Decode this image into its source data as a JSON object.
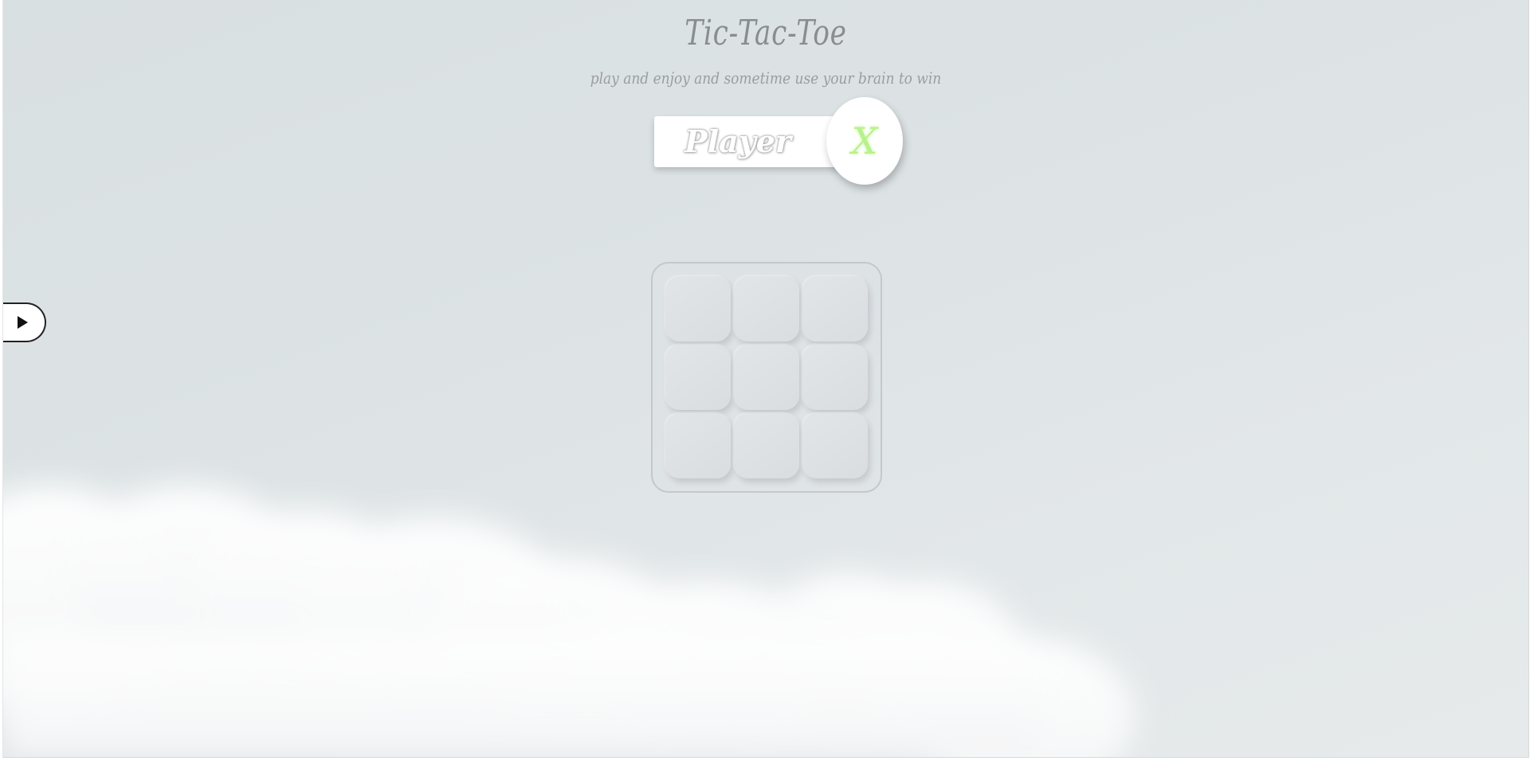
{
  "game": {
    "title": "Tic-Tac-Toe",
    "subtitle": "play and enjoy and sometime use your brain to win",
    "player_label": "Player",
    "current_mark": "X",
    "mark_color": "#b7f28a"
  },
  "board": {
    "cells": [
      "",
      "",
      "",
      "",
      "",
      "",
      "",
      "",
      ""
    ]
  },
  "side_toggle": {
    "icon": "play-icon"
  },
  "colors": {
    "background": "#dde3e5",
    "text": "#8a8d8f",
    "cell": "#dfe2e4"
  }
}
